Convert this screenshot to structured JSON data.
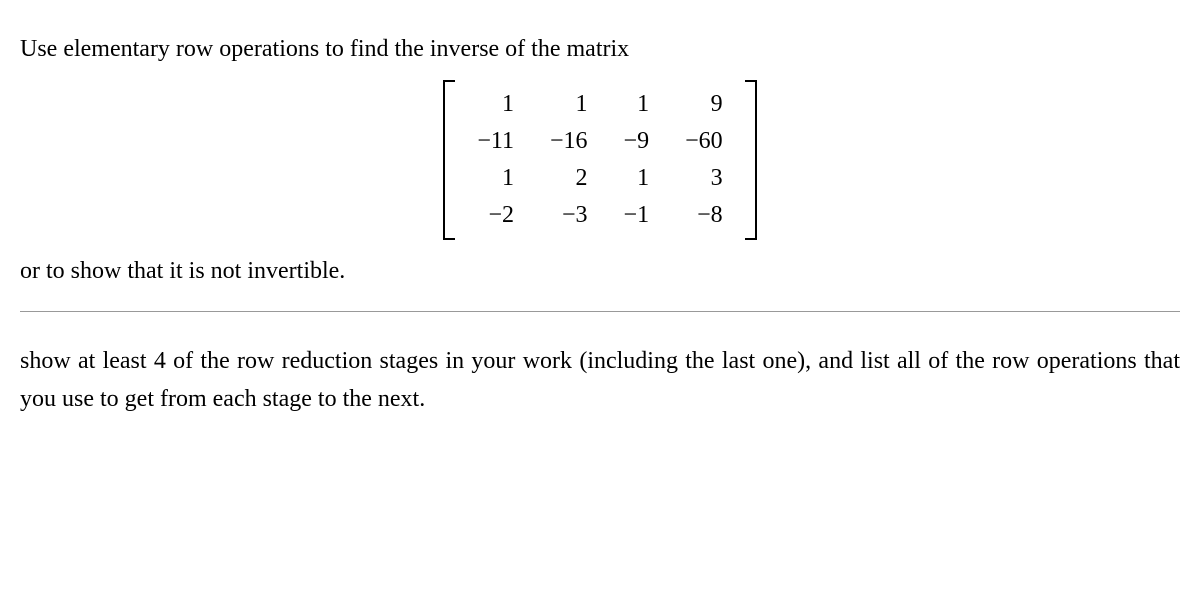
{
  "text": {
    "intro": "Use elementary row operations to find the inverse of the matrix",
    "after": "or to show that it is not invertible.",
    "instruct_lead": "show at least 4 of the row reduction stages in your work",
    "instruct_cont": "(including the last one), and list all of the row operations that you use to get from each stage to the next."
  },
  "matrix": {
    "r1": {
      "c1": "1",
      "c2": "1",
      "c3": "1",
      "c4": "9"
    },
    "r2": {
      "c1": "−11",
      "c2": "−16",
      "c3": "−9",
      "c4": "−60"
    },
    "r3": {
      "c1": "1",
      "c2": "2",
      "c3": "1",
      "c4": "3"
    },
    "r4": {
      "c1": "−2",
      "c2": "−3",
      "c3": "−1",
      "c4": "−8"
    }
  }
}
